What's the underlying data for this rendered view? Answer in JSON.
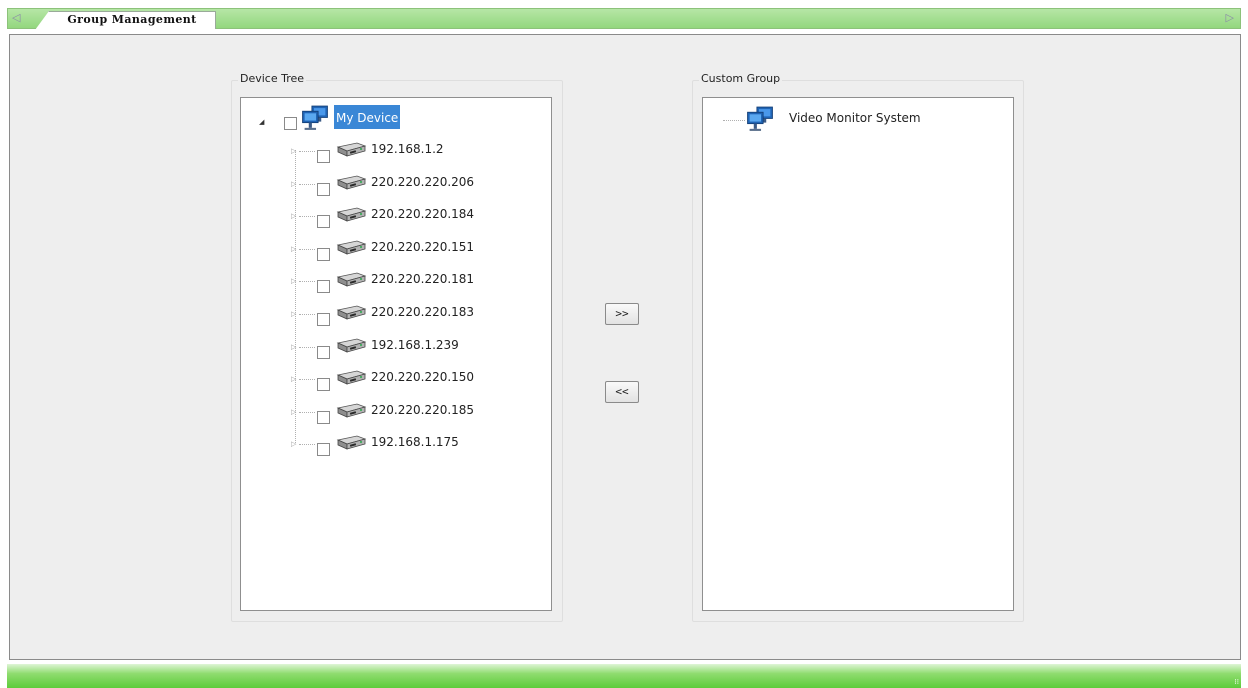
{
  "tab": {
    "title": "Group Management",
    "left_arrow": "◁",
    "right_arrow": "▷"
  },
  "device_tree": {
    "title": "Device Tree",
    "root": {
      "label": "My Device",
      "selected": true,
      "expanded": true
    },
    "devices": [
      {
        "label": "192.168.1.2"
      },
      {
        "label": "220.220.220.206"
      },
      {
        "label": "220.220.220.184"
      },
      {
        "label": "220.220.220.151"
      },
      {
        "label": "220.220.220.181"
      },
      {
        "label": "220.220.220.183"
      },
      {
        "label": "192.168.1.239"
      },
      {
        "label": "220.220.220.150"
      },
      {
        "label": "220.220.220.185"
      },
      {
        "label": "192.168.1.175"
      }
    ]
  },
  "custom_group": {
    "title": "Custom Group",
    "root": {
      "label": "Video Monitor System"
    }
  },
  "buttons": {
    "add": ">>",
    "remove": "<<"
  },
  "colors": {
    "selection": "#3a87d6",
    "tab_bar": "#9bdb84",
    "bottom_bar": "#5ccc3a"
  }
}
